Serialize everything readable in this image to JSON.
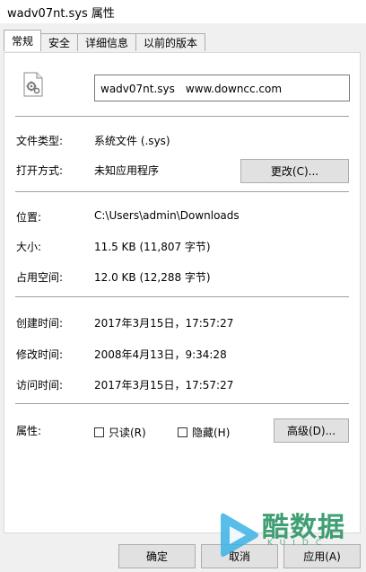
{
  "window": {
    "title": "wadv07nt.sys 属性"
  },
  "tabs": [
    {
      "label": "常规"
    },
    {
      "label": "安全"
    },
    {
      "label": "详细信息"
    },
    {
      "label": "以前的版本"
    }
  ],
  "general": {
    "file_name": "wadv07nt.sys　www.downcc.com",
    "file_type_label": "文件类型:",
    "file_type_value": "系统文件 (.sys)",
    "open_with_label": "打开方式:",
    "open_with_value": "未知应用程序",
    "change_button": "更改(C)...",
    "location_label": "位置:",
    "location_value": "C:\\Users\\admin\\Downloads",
    "size_label": "大小:",
    "size_value": "11.5 KB (11,807 字节)",
    "size_on_disk_label": "占用空间:",
    "size_on_disk_value": "12.0 KB (12,288 字节)",
    "created_label": "创建时间:",
    "created_value": "2017年3月15日，17:57:27",
    "modified_label": "修改时间:",
    "modified_value": "2008年4月13日，9:34:28",
    "accessed_label": "访问时间:",
    "accessed_value": "2017年3月15日，17:57:27",
    "attributes_label": "属性:",
    "readonly_label": "只读(R)",
    "hidden_label": "隐藏(H)",
    "advanced_button": "高级(D)..."
  },
  "footer": {
    "ok_button": "确定",
    "cancel_button": "取消",
    "apply_button": "应用(A)"
  },
  "watermark": {
    "text": "酷数据",
    "sub": "KUIDC"
  },
  "icons": {
    "file": "system-file-gear-icon",
    "logo": "play-logo-icon"
  },
  "colors": {
    "accent": "#1f8f5c",
    "button_bg": "#e1e1e1",
    "panel_bg": "#ffffff"
  }
}
